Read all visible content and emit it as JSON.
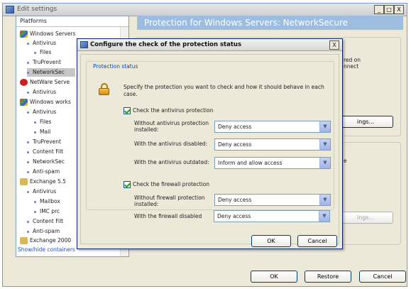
{
  "window": {
    "title": "Edit settings",
    "min": "_",
    "max": "□",
    "close": "X"
  },
  "platforms": {
    "header": "Platforms",
    "items": [
      {
        "label": "Windows Servers",
        "icon": "windows-icon"
      },
      {
        "label": "Antivirus"
      },
      {
        "label": "Files"
      },
      {
        "label": "TruPrevent"
      },
      {
        "label": "NetworkSec"
      },
      {
        "label": "NetWare Serve",
        "icon": "netware-icon"
      },
      {
        "label": "Antivirus"
      },
      {
        "label": "Windows works",
        "icon": "windows-icon"
      },
      {
        "label": "Antivirus"
      },
      {
        "label": "Files"
      },
      {
        "label": "Mail"
      },
      {
        "label": "TruPrevent"
      },
      {
        "label": "Content Filt"
      },
      {
        "label": "NetworkSec"
      },
      {
        "label": "Anti-spam"
      },
      {
        "label": "Exchange 5.5",
        "icon": "exchange-icon"
      },
      {
        "label": "Antivirus"
      },
      {
        "label": "Mailbox"
      },
      {
        "label": "IMC prc"
      },
      {
        "label": "Content Filt"
      },
      {
        "label": "Anti-spam"
      },
      {
        "label": "Exchange 2000",
        "icon": "exchange-icon"
      }
    ],
    "show_hide": "Show/hide containers"
  },
  "right_panel": {
    "title": "Protection for Windows Servers: NetworkSecure",
    "text1_line1": "red on",
    "text1_line2": "nnect",
    "settings_btn": "ings...",
    "text2": "e",
    "settings_btn2": "ings..."
  },
  "main_buttons": {
    "ok": "OK",
    "restore": "Restore",
    "cancel": "Cancel"
  },
  "dialog": {
    "title": "Configure the check of the protection status",
    "close": "X",
    "group_title": "Protection status",
    "description": "Specify the protection you want to check and how it should behave in each case.",
    "antivirus": {
      "check_label": "Check the antivirus protection",
      "checked": true,
      "rows": [
        {
          "label": "Without antivirus protection installed:",
          "value": "Deny access"
        },
        {
          "label": "With the antivirus disabled:",
          "value": "Deny access"
        },
        {
          "label": "With the antivirus outdated:",
          "value": "Inform and allow access"
        }
      ]
    },
    "firewall": {
      "check_label": "Check the firewall protection",
      "checked": true,
      "rows": [
        {
          "label": "Without firewall protection installed:",
          "value": "Deny access"
        },
        {
          "label": "With the firewall disabled",
          "value": "Deny access"
        }
      ]
    },
    "ok": "OK",
    "cancel": "Cancel"
  }
}
